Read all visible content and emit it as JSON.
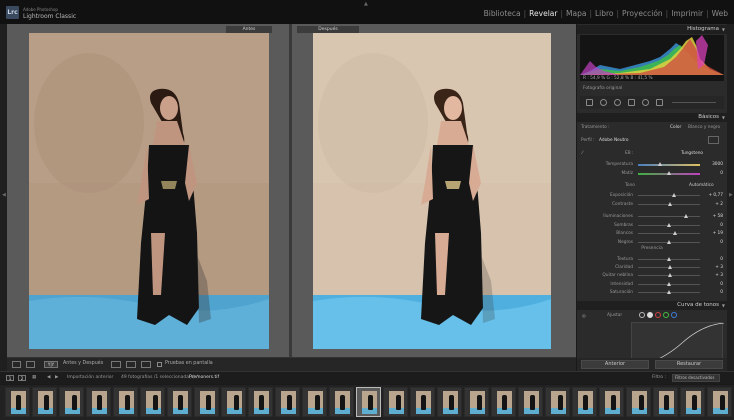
{
  "app": {
    "logo": "Lrc",
    "brand_small": "Adobe Photoshop",
    "brand_name": "Lightroom Classic"
  },
  "modules": [
    {
      "label": "Biblioteca",
      "active": false
    },
    {
      "label": "Revelar",
      "active": true
    },
    {
      "label": "Mapa",
      "active": false
    },
    {
      "label": "Libro",
      "active": false
    },
    {
      "label": "Proyección",
      "active": false
    },
    {
      "label": "Imprimir",
      "active": false
    },
    {
      "label": "Web",
      "active": false
    }
  ],
  "view": {
    "before_label": "Antes",
    "after_label": "Después"
  },
  "toolbar": {
    "view_mode": "Antes y Después",
    "yy_label": "Y|Y",
    "proof_label": "Pruebas en pantalla"
  },
  "histogram_panel": {
    "title": "Histograma",
    "readout": "R : 54,9 %   G : 52,8 %   B : 41,5 %",
    "original_label": "Fotografía original"
  },
  "basic_panel": {
    "title": "Básicos",
    "treatment_label": "Tratamiento :",
    "treatment_color": "Color",
    "treatment_bw": "Blanco y negro",
    "profile_label": "Perfil :",
    "profile_value": "Adobe Neutro",
    "wb_label": "EB :",
    "wb_value": "Tungsteno",
    "tone_label": "Tono",
    "tone_auto": "Automático",
    "presence_label": "Presencia",
    "sliders": [
      {
        "label": "Temperatura",
        "value": "3000",
        "pos": 0.35
      },
      {
        "label": "Matiz",
        "value": "0",
        "pos": 0.5
      },
      {
        "label": "Exposición",
        "value": "+ 0,77",
        "pos": 0.58
      },
      {
        "label": "Contraste",
        "value": "+ 2",
        "pos": 0.52
      },
      {
        "label": "Iluminaciones",
        "value": "+ 58",
        "pos": 0.78
      },
      {
        "label": "Sombras",
        "value": "0",
        "pos": 0.5
      },
      {
        "label": "Blancos",
        "value": "+ 19",
        "pos": 0.6
      },
      {
        "label": "Negros",
        "value": "0",
        "pos": 0.5
      },
      {
        "label": "Textura",
        "value": "0",
        "pos": 0.5
      },
      {
        "label": "Claridad",
        "value": "+ 3",
        "pos": 0.52
      },
      {
        "label": "Quitar neblina",
        "value": "+ 3",
        "pos": 0.52
      },
      {
        "label": "Intensidad",
        "value": "0",
        "pos": 0.5
      },
      {
        "label": "Saturación",
        "value": "0",
        "pos": 0.5
      }
    ]
  },
  "curve_panel": {
    "title": "Curva de tonos",
    "adjust_label": "Ajustar"
  },
  "panel_buttons": {
    "previous": "Anterior",
    "reset": "Restaurar"
  },
  "filmstrip_bar": {
    "pages": [
      "1",
      "2"
    ],
    "previous_import": "Importación anterior",
    "count_text": "49 fotografías /1 seleccionada(s) /",
    "filename": "Premoners.tif",
    "filter_label": "Filtro :",
    "filter_value": "Filtros desactivados"
  },
  "thumbnail_count": 27,
  "selected_thumbnail": 13,
  "colors": {
    "active_module": "#e6e6e6",
    "inactive_module": "#8c8c8c",
    "panel_bg": "#2b2b2b",
    "background_blue": "#5faed0"
  }
}
